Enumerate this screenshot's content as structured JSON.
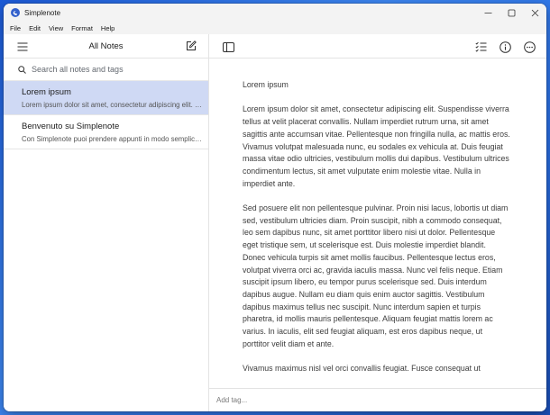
{
  "window": {
    "title": "Simplenote",
    "accent": "#3361cc",
    "selected_bg": "#cfd9f4"
  },
  "menubar": {
    "items": [
      "File",
      "Edit",
      "View",
      "Format",
      "Help"
    ]
  },
  "sidebar": {
    "header_title": "All Notes",
    "search_placeholder": "Search all notes and tags",
    "notes": [
      {
        "title": "Lorem ipsum",
        "preview": "Lorem ipsum dolor sit amet, consectetur adipiscing elit. Suspendisse viverra",
        "selected": true
      },
      {
        "title": "Benvenuto su Simplenote",
        "preview": "Con Simplenote puoi prendere appunti in modo semplice e veloce",
        "selected": false
      }
    ]
  },
  "editor": {
    "heading": "Lorem ipsum",
    "paragraphs": [
      "Lorem ipsum dolor sit amet, consectetur adipiscing elit. Suspendisse viverra tellus at velit placerat convallis. Nullam imperdiet rutrum urna, sit amet sagittis ante accumsan vitae. Pellentesque non fringilla nulla, ac mattis eros. Vivamus volutpat malesuada nunc, eu sodales ex vehicula at. Duis feugiat massa vitae odio ultricies, vestibulum mollis dui dapibus. Vestibulum ultrices condimentum lectus, sit amet vulputate enim molestie vitae. Nulla in imperdiet ante.",
      "Sed posuere elit non pellentesque pulvinar. Proin nisi lacus, lobortis ut diam sed, vestibulum ultricies diam. Proin suscipit, nibh a commodo consequat, leo sem dapibus nunc, sit amet porttitor libero nisi ut dolor. Pellentesque eget tristique sem, ut scelerisque est. Duis molestie imperdiet blandit. Donec vehicula turpis sit amet mollis faucibus. Pellentesque lectus eros, volutpat viverra orci ac, gravida iaculis massa. Nunc vel felis neque. Etiam suscipit ipsum libero, eu tempor purus scelerisque sed. Duis interdum dapibus augue. Nullam eu diam quis enim auctor sagittis. Vestibulum dapibus maximus tellus nec suscipit. Nunc interdum sapien et turpis pharetra, id mollis mauris pellentesque. Aliquam feugiat mattis lorem ac varius. In iaculis, elit sed feugiat aliquam, est eros dapibus neque, ut porttitor velit diam et ante.",
      "Vivamus maximus nisl vel orci convallis feugiat. Fusce consequat ut"
    ],
    "tag_placeholder": "Add tag..."
  },
  "icons": {
    "menu": "hamburger-menu-icon",
    "new_note": "new-note-icon",
    "sidebar_toggle": "sidebar-toggle-icon",
    "checklist": "checklist-icon",
    "info": "info-icon",
    "more": "more-options-icon",
    "search": "search-icon"
  }
}
